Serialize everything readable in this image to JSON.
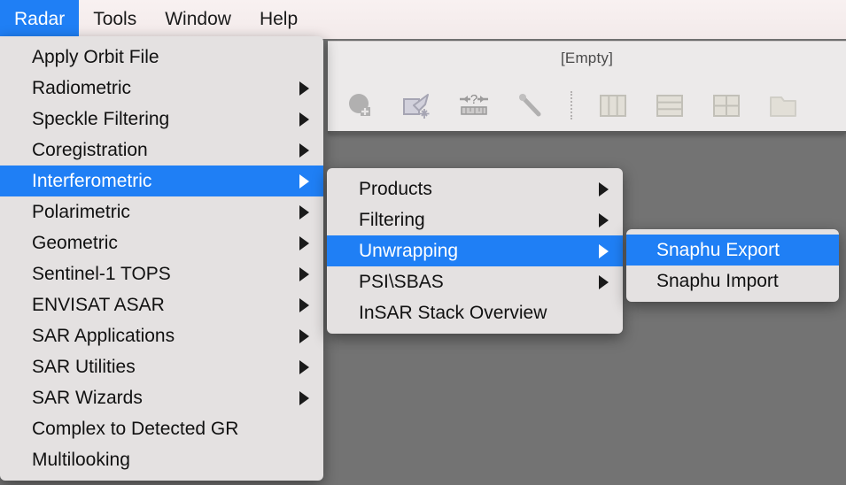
{
  "desktop": {
    "background_color": "#737373"
  },
  "menubar": {
    "background_color": "#f5eded",
    "highlight_color": "#1f7ff5",
    "items": [
      {
        "label": "Radar",
        "active": true
      },
      {
        "label": "Tools",
        "active": false
      },
      {
        "label": "Window",
        "active": false
      },
      {
        "label": "Help",
        "active": false
      }
    ]
  },
  "window": {
    "title": "[Empty]",
    "toolbar": {
      "buttons": [
        {
          "icon": "open-product-icon"
        },
        {
          "icon": "import-vector-icon"
        },
        {
          "icon": "range-question-icon"
        },
        {
          "icon": "magic-wand-icon"
        },
        {
          "icon": "separator"
        },
        {
          "icon": "tile-vertical-icon"
        },
        {
          "icon": "tile-horizontal-icon"
        },
        {
          "icon": "tile-grid-icon"
        },
        {
          "icon": "window-folder-icon"
        }
      ]
    }
  },
  "menus": {
    "radar": {
      "title": "Radar",
      "items": [
        {
          "label": "Apply Orbit File",
          "submenu": false,
          "selected": false
        },
        {
          "label": "Radiometric",
          "submenu": true,
          "selected": false
        },
        {
          "label": "Speckle Filtering",
          "submenu": true,
          "selected": false
        },
        {
          "label": "Coregistration",
          "submenu": true,
          "selected": false
        },
        {
          "label": "Interferometric",
          "submenu": true,
          "selected": true
        },
        {
          "label": "Polarimetric",
          "submenu": true,
          "selected": false
        },
        {
          "label": "Geometric",
          "submenu": true,
          "selected": false
        },
        {
          "label": "Sentinel-1 TOPS",
          "submenu": true,
          "selected": false
        },
        {
          "label": "ENVISAT ASAR",
          "submenu": true,
          "selected": false
        },
        {
          "label": "SAR Applications",
          "submenu": true,
          "selected": false
        },
        {
          "label": "SAR Utilities",
          "submenu": true,
          "selected": false
        },
        {
          "label": "SAR Wizards",
          "submenu": true,
          "selected": false
        },
        {
          "label": "Complex to Detected GR",
          "submenu": false,
          "selected": false
        },
        {
          "label": "Multilooking",
          "submenu": false,
          "selected": false
        }
      ]
    },
    "interferometric": {
      "title": "Interferometric",
      "items": [
        {
          "label": "Products",
          "submenu": true,
          "selected": false
        },
        {
          "label": "Filtering",
          "submenu": true,
          "selected": false
        },
        {
          "label": "Unwrapping",
          "submenu": true,
          "selected": true
        },
        {
          "label": "PSI\\SBAS",
          "submenu": true,
          "selected": false
        },
        {
          "label": "InSAR Stack Overview",
          "submenu": false,
          "selected": false
        }
      ]
    },
    "unwrapping": {
      "title": "Unwrapping",
      "items": [
        {
          "label": "Snaphu Export",
          "submenu": false,
          "selected": true
        },
        {
          "label": "Snaphu Import",
          "submenu": false,
          "selected": false
        }
      ]
    }
  }
}
